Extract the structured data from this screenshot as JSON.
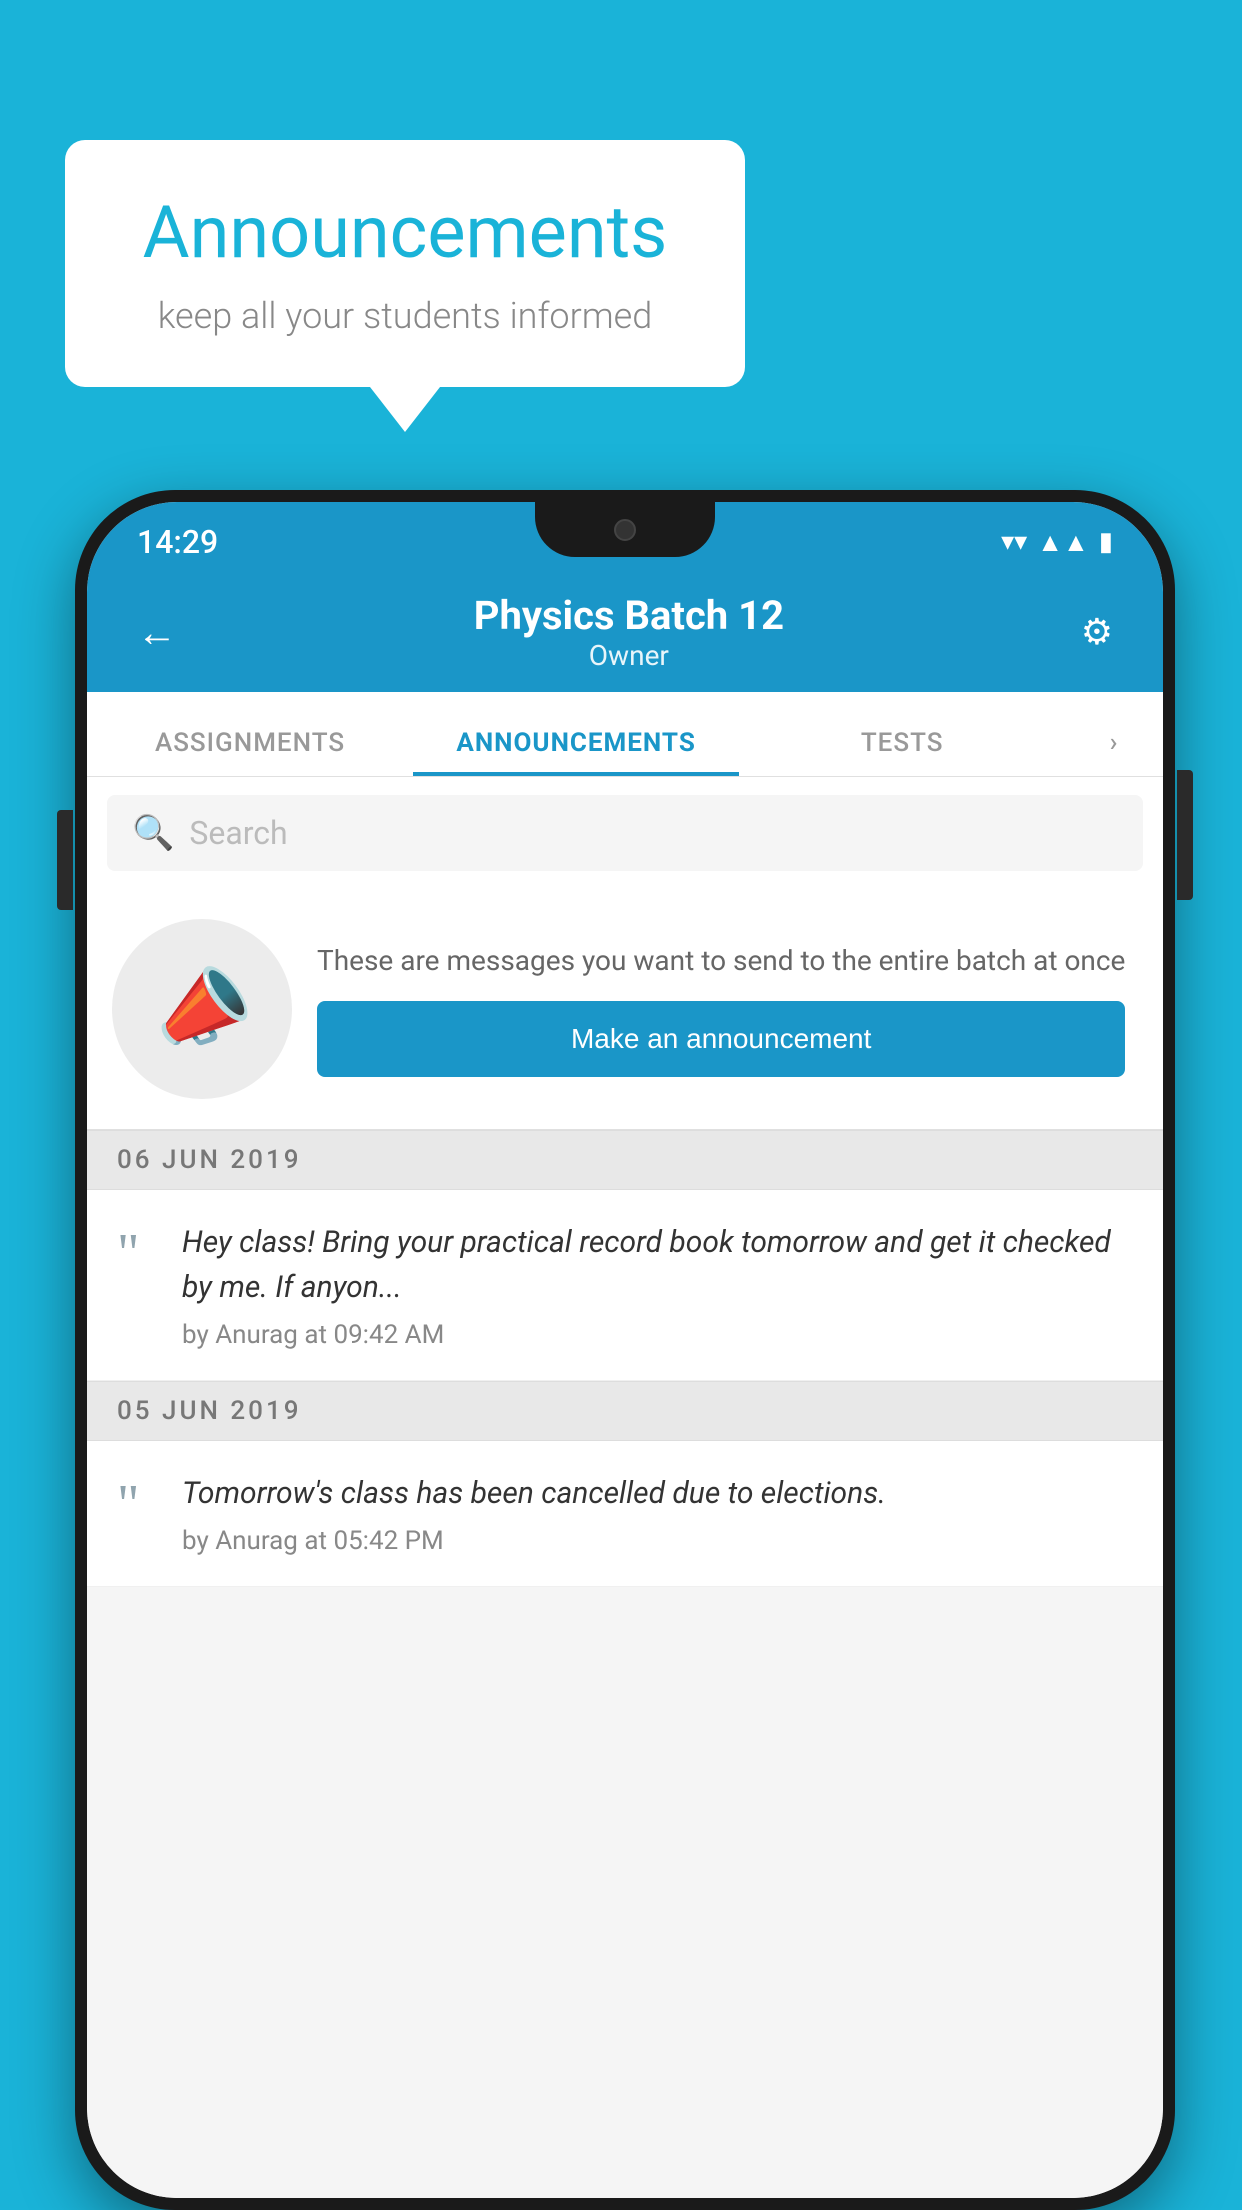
{
  "background_color": "#1ab3d8",
  "speech_bubble": {
    "title": "Announcements",
    "subtitle": "keep all your students informed"
  },
  "status_bar": {
    "time": "14:29",
    "wifi": "▼",
    "signal": "▲",
    "battery": "▮"
  },
  "app_bar": {
    "title": "Physics Batch 12",
    "subtitle": "Owner",
    "back_label": "←",
    "settings_label": "⚙"
  },
  "tabs": [
    {
      "label": "ASSIGNMENTS",
      "active": false
    },
    {
      "label": "ANNOUNCEMENTS",
      "active": true
    },
    {
      "label": "TESTS",
      "active": false
    },
    {
      "label": "›",
      "active": false
    }
  ],
  "search": {
    "placeholder": "Search"
  },
  "promo": {
    "text": "These are messages you want to send to the entire batch at once",
    "button_label": "Make an announcement"
  },
  "announcements": [
    {
      "date": "06  JUN  2019",
      "text": "Hey class! Bring your practical record book tomorrow and get it checked by me. If anyon...",
      "meta": "by Anurag at 09:42 AM"
    },
    {
      "date": "05  JUN  2019",
      "text": "Tomorrow's class has been cancelled due to elections.",
      "meta": "by Anurag at 05:42 PM"
    }
  ]
}
